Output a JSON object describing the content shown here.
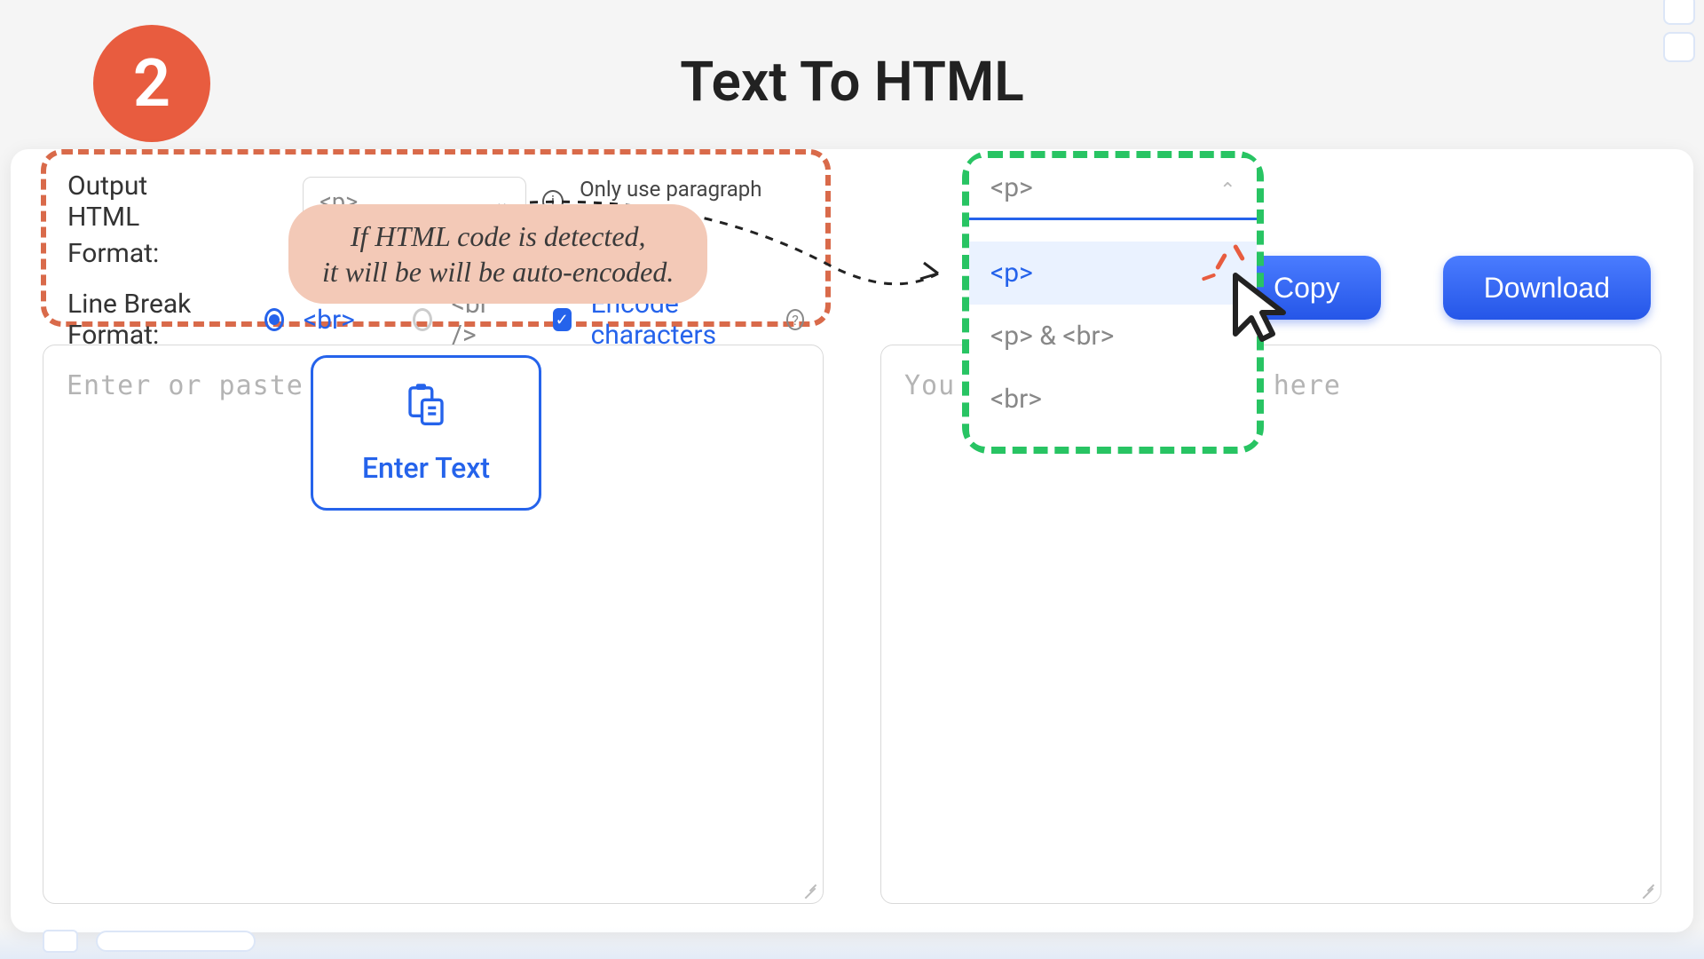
{
  "step_number": "2",
  "title": "Text To HTML",
  "controls": {
    "output_html_label": "Output HTML",
    "format_label": "Format:",
    "select_value": "<p>",
    "hint_only_paragraph": "Only use paragraph labels",
    "line_break_label": "Line  Break  Format:",
    "radio_br": "<br>",
    "radio_br_slash": "<br />",
    "encode_label": "Encode characters"
  },
  "buttons": {
    "copy_faded": "Co",
    "copy": "Copy",
    "download": "Download",
    "enter_text": "Enter Text"
  },
  "placeholders": {
    "left": "Enter or paste yo",
    "right_pre": "You",
    "right_post": "yed here"
  },
  "callout": {
    "line1": "If HTML code is detected,",
    "line2": "it will be will be auto-encoded."
  },
  "dropdown": {
    "selected": "<p>",
    "options": [
      "<p>",
      "<p> & <br>",
      "<br>"
    ]
  }
}
